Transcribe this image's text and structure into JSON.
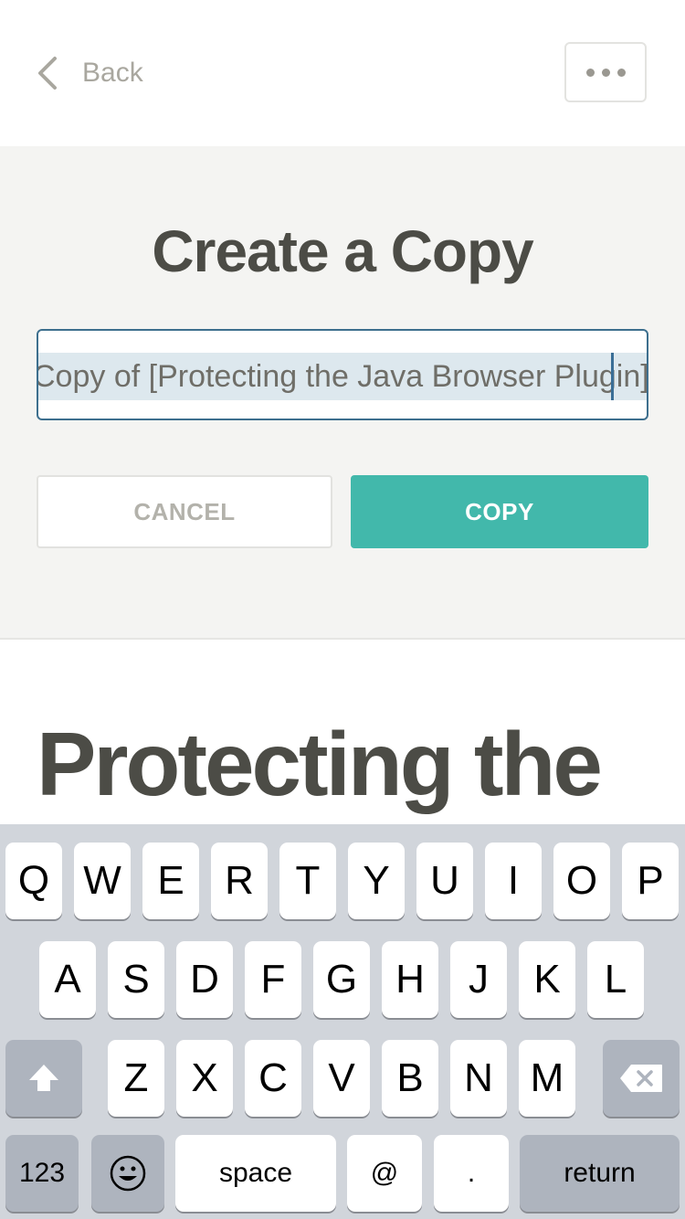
{
  "nav": {
    "back_label": "Back"
  },
  "dialog": {
    "title": "Create a Copy",
    "input_value": "Copy of [Protecting the Java Browser Plugin]",
    "cancel_label": "CANCEL",
    "copy_label": "COPY"
  },
  "article": {
    "heading": "Protecting the"
  },
  "keyboard": {
    "row1": [
      "Q",
      "W",
      "E",
      "R",
      "T",
      "Y",
      "U",
      "I",
      "O",
      "P"
    ],
    "row2": [
      "A",
      "S",
      "D",
      "F",
      "G",
      "H",
      "J",
      "K",
      "L"
    ],
    "row3": [
      "Z",
      "X",
      "C",
      "V",
      "B",
      "N",
      "M"
    ],
    "numbers_label": "123",
    "space_label": "space",
    "at_label": "@",
    "period_label": ".",
    "return_label": "return"
  },
  "colors": {
    "accent": "#42b8ab",
    "title": "#4c4c46",
    "field_border": "#3d6f8e"
  }
}
